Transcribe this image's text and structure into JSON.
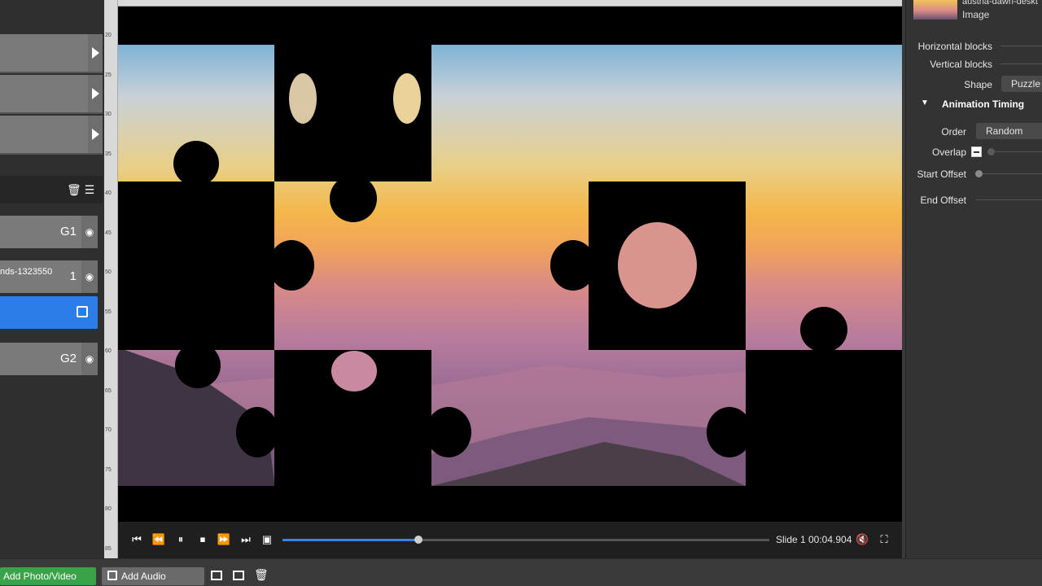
{
  "left_panel": {
    "layers": [
      {
        "label": "G1"
      },
      {
        "label": "1",
        "sub": "nds-1323550"
      },
      {
        "label": ""
      },
      {
        "label": "G2"
      }
    ]
  },
  "ruler_ticks": [
    "20",
    "25",
    "30",
    "35",
    "40",
    "45",
    "50",
    "55",
    "60",
    "65",
    "70",
    "75",
    "80",
    "85"
  ],
  "transport": {
    "slide_label": "Slide 1",
    "timecode": "00:04.904",
    "progress": 0.28
  },
  "properties": {
    "file_name": "austria-dawn-deskt",
    "file_type": "Image",
    "horizontal_blocks_label": "Horizontal blocks",
    "vertical_blocks_label": "Vertical blocks",
    "shape_label": "Shape",
    "shape_value": "Puzzle P",
    "section_title": "Animation Timing",
    "order_label": "Order",
    "order_value": "Random",
    "overlap_label": "Overlap",
    "start_offset_label": "Start Offset",
    "end_offset_label": "End Offset"
  },
  "bottom_bar": {
    "add_photo_label": "Add Photo/Video",
    "add_audio_label": "Add Audio"
  },
  "colors": {
    "accent_blue": "#2b7de9",
    "add_photo_green": "#3aa34a",
    "panel_bg": "#333333"
  }
}
